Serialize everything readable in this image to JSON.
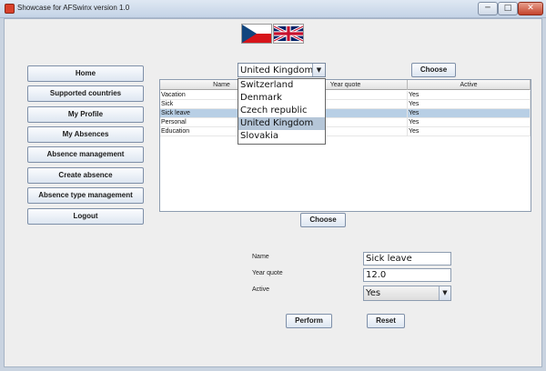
{
  "window": {
    "title": "Showcase for AFSwinx version 1.0",
    "min": "─",
    "max": "□",
    "close": "✕"
  },
  "flags": [
    "czech-flag",
    "uk-flag"
  ],
  "nav": [
    "Home",
    "Supported countries",
    "My Profile",
    "My Absences",
    "Absence management",
    "Create absence",
    "Absence type management",
    "Logout"
  ],
  "country_select": {
    "selected": "United Kingdom",
    "options": [
      "Switzerland",
      "Denmark",
      "Czech republic",
      "United Kingdom",
      "Slovakia"
    ],
    "choose_label": "Choose"
  },
  "table": {
    "columns": [
      "Name",
      "Year quote",
      "Active"
    ],
    "rows": [
      {
        "name": "Vacation",
        "quote": "",
        "active": "Yes"
      },
      {
        "name": "Sick",
        "quote": "",
        "active": "Yes"
      },
      {
        "name": "Sick leave",
        "quote": "",
        "active": "Yes"
      },
      {
        "name": "Personal",
        "quote": "",
        "active": "Yes"
      },
      {
        "name": "Education",
        "quote": "",
        "active": "Yes"
      }
    ],
    "selected_row": 2,
    "choose_label": "Choose"
  },
  "form": {
    "name_label": "Name",
    "name_value": "Sick leave",
    "quote_label": "Year quote",
    "quote_value": "12.0",
    "active_label": "Active",
    "active_value": "Yes",
    "perform_label": "Perform",
    "reset_label": "Reset"
  },
  "colors": {
    "selection": "#b8cfe5",
    "dropdown_highlight": "#b5c6d8",
    "czech_red": "#d7141a",
    "czech_blue": "#11457e",
    "uk_blue": "#012169",
    "uk_red": "#c8102e"
  }
}
